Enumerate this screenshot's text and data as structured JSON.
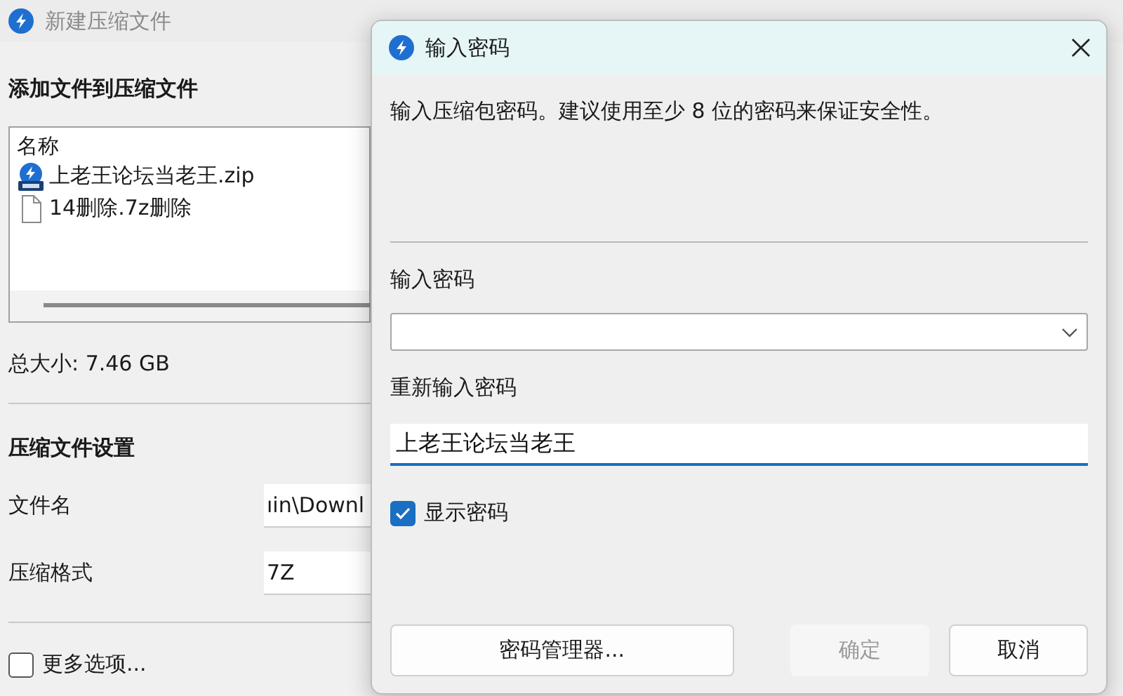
{
  "main_window": {
    "title": "新建压缩文件",
    "add_section": {
      "heading": "添加文件到压缩文件",
      "list_header": "名称",
      "files": [
        {
          "name": "上老王论坛当老王.zip",
          "kind": "archive"
        },
        {
          "name": "14删除.7z删除",
          "kind": "file"
        }
      ]
    },
    "total_size": "总大小: 7.46 GB",
    "settings": {
      "heading": "压缩文件设置",
      "fields": [
        {
          "label": "文件名",
          "value": "ıin\\Downl"
        },
        {
          "label": "压缩格式",
          "value": "7Z"
        }
      ]
    },
    "more_options": {
      "label": "更多选项...",
      "checked": false
    }
  },
  "dialog": {
    "title": "输入密码",
    "description": "输入压缩包密码。建议使用至少 8 位的密码来保证安全性。",
    "password": {
      "label": "输入密码"
    },
    "confirm": {
      "label": "重新输入密码",
      "value": "上老王论坛当老王"
    },
    "show_password": {
      "label": "显示密码",
      "checked": true
    },
    "buttons": [
      {
        "label": "密码管理器...",
        "kind": "wide",
        "disabled": false
      },
      {
        "label": "确定",
        "kind": "normal",
        "disabled": true
      },
      {
        "label": "取消",
        "kind": "normal",
        "disabled": false
      }
    ]
  }
}
